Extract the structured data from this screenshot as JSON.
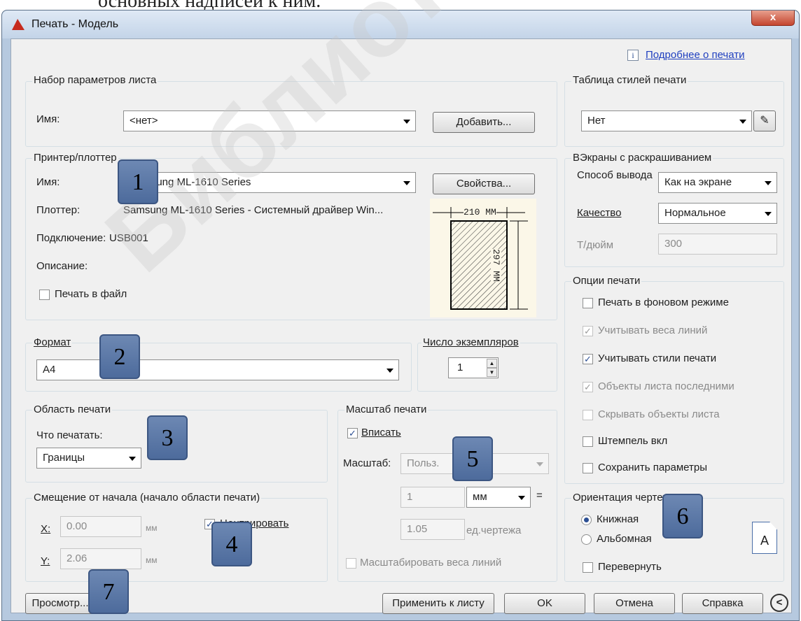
{
  "top_text": "основных надписей к ним.",
  "window": {
    "title": "Печать - Модель",
    "close": "x"
  },
  "help_link": {
    "icon": "i",
    "label": "Подробнее о печати"
  },
  "page_setup": {
    "group": "Набор параметров листа",
    "name_label": "Имя:",
    "name_value": "<нет>",
    "add_button": "Добавить..."
  },
  "printer": {
    "group": "Принтер/плоттер",
    "name_label": "Имя:",
    "name_value": "Samsung ML-1610 Series",
    "properties_button": "Свойства...",
    "plotter_label": "Плоттер:",
    "plotter_value": "Samsung ML-1610 Series - Системный драйвер Win...",
    "port_label": "Подключение:",
    "port_value": "USB001",
    "desc_label": "Описание:",
    "print_to_file": "Печать в файл",
    "preview_width": "210 ММ",
    "preview_height": "297 ММ"
  },
  "paper": {
    "group": "Формат",
    "value": "A4"
  },
  "copies": {
    "group": "Число экземпляров",
    "value": "1"
  },
  "area": {
    "group": "Область печати",
    "what_label": "Что печатать:",
    "what_value": "Границы"
  },
  "offset": {
    "group": "Смещение от начала (начало области печати)",
    "x_label": "X:",
    "x_value": "0.00",
    "y_label": "Y:",
    "y_value": "2.06",
    "unit": "мм",
    "center_label": "Центрировать",
    "center_label_visible": "Центрировать"
  },
  "scale": {
    "group": "Масштаб печати",
    "fit_label": "Вписать",
    "scale_label": "Масштаб:",
    "scale_value": "Польз.",
    "v1": "1",
    "unit": "мм",
    "eq": "=",
    "v2": "1.05",
    "drawing_units": "ед.чертежа",
    "lineweights": "Масштабировать веса линий"
  },
  "style_table": {
    "group": "Таблица стилей печати",
    "value": "Нет"
  },
  "shaded": {
    "group": "ВЭкраны с раскрашиванием",
    "mode_label": "Способ вывода",
    "mode_value": "Как на экране",
    "quality_label": "Качество",
    "quality_value": "Нормальное",
    "dpi_label": "Т/дюйм",
    "dpi_value": "300"
  },
  "options": {
    "group": "Опции печати",
    "items": [
      "Печать в фоновом режиме",
      "Учитывать веса линий",
      "Учитывать стили печати",
      "Объекты листа последними",
      "Скрывать объекты листа",
      "Штемпель вкл",
      "Сохранить параметры"
    ]
  },
  "orientation": {
    "group": "Ориентация чертежа",
    "portrait": "Книжная",
    "landscape": "Альбомная",
    "upside_down": "Перевернуть",
    "icon_letter": "A"
  },
  "buttons": {
    "preview": "Просмотр...",
    "apply": "Применить к листу",
    "ok": "OK",
    "cancel": "Отмена",
    "help": "Справка",
    "expand": "<"
  },
  "callouts": [
    "1",
    "2",
    "3",
    "4",
    "5",
    "6",
    "7"
  ],
  "watermark": "Библиотека ГГТУ"
}
